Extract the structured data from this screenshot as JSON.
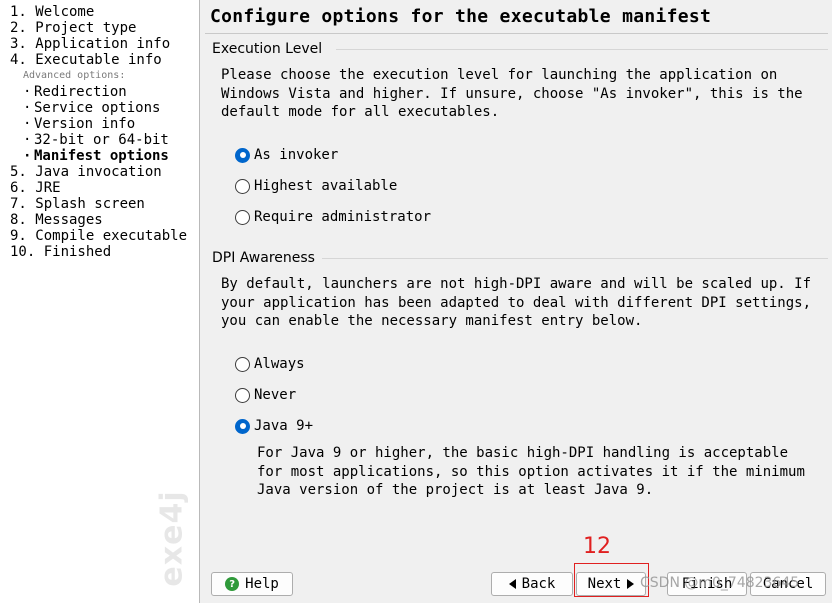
{
  "sidebar": {
    "steps": [
      "1. Welcome",
      "2. Project type",
      "3. Application info",
      "4. Executable info"
    ],
    "advanced_label": "Advanced options:",
    "sub_steps": [
      "Redirection",
      "Service options",
      "Version info",
      "32-bit or 64-bit",
      "Manifest options"
    ],
    "steps_after": [
      "5. Java invocation",
      "6. JRE",
      "7. Splash screen",
      "8. Messages",
      "9. Compile executable",
      "10. Finished"
    ],
    "watermark": "exe4j"
  },
  "main": {
    "title": "Configure options for the executable manifest",
    "execution": {
      "legend": "Execution Level",
      "description": "Please choose the execution level for launching the application on Windows Vista and higher. If unsure, choose \"As invoker\", this is the default mode for all executables.",
      "options": [
        "As invoker",
        "Highest available",
        "Require administrator"
      ],
      "selected": "As invoker"
    },
    "dpi": {
      "legend": "DPI Awareness",
      "description": "By default, launchers are not high-DPI aware and will be scaled up. If your application has been adapted to deal with different DPI settings, you can enable the necessary manifest entry below.",
      "options": [
        "Always",
        "Never",
        "Java 9+"
      ],
      "selected": "Java 9+",
      "note": "For Java 9 or higher, the basic high-DPI handling is acceptable for most applications, so this option activates it if the minimum Java version of the project is at least Java 9."
    }
  },
  "buttons": {
    "help": "Help",
    "back": "Back",
    "next": "Next",
    "finish": "Finish",
    "cancel": "Cancel"
  },
  "annotation": {
    "number": "12",
    "watermark_text": "CSDN @m0_74823645"
  },
  "colors": {
    "radio_selected": "#0066cc",
    "annotation": "#e02020",
    "help_icon": "#2f9a3a"
  }
}
